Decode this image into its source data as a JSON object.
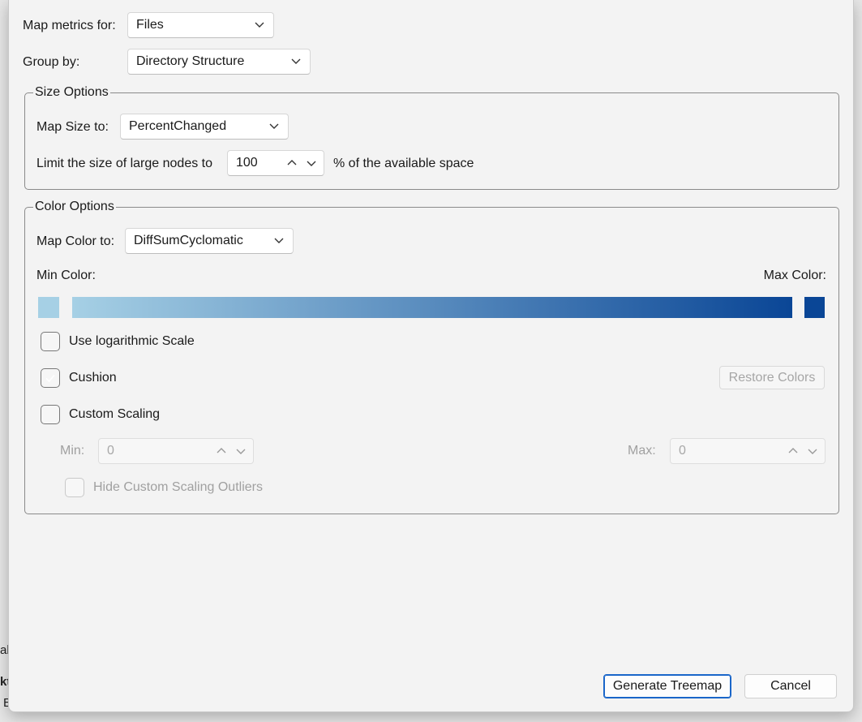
{
  "background": {
    "fragments": [
      "al",
      "kt",
      "E"
    ]
  },
  "form": {
    "map_metrics_label": "Map metrics for:",
    "map_metrics_value": "Files",
    "group_by_label": "Group by:",
    "group_by_value": "Directory Structure"
  },
  "size_options": {
    "title": "Size Options",
    "map_size_label": "Map Size to:",
    "map_size_value": "PercentChanged",
    "limit_label": "Limit the size of large nodes to",
    "limit_value": "100",
    "limit_suffix": "% of the available space"
  },
  "color_options": {
    "title": "Color Options",
    "map_color_label": "Map Color to:",
    "map_color_value": "DiffSumCyclomatic",
    "min_color_label": "Min Color:",
    "max_color_label": "Max Color:",
    "min_color": "#a6d0e5",
    "max_color": "#0a4696",
    "use_log_label": "Use logarithmic Scale",
    "use_log_checked": false,
    "cushion_label": "Cushion",
    "cushion_checked": true,
    "restore_colors_label": "Restore Colors",
    "custom_scaling_label": "Custom Scaling",
    "custom_scaling_checked": false,
    "min_label": "Min:",
    "min_value": "0",
    "max_label": "Max:",
    "max_value": "0",
    "hide_outliers_label": "Hide Custom Scaling Outliers",
    "hide_outliers_checked": false
  },
  "footer": {
    "generate_label": "Generate Treemap",
    "cancel_label": "Cancel"
  },
  "colors": {
    "accent": "#1a66c9"
  }
}
